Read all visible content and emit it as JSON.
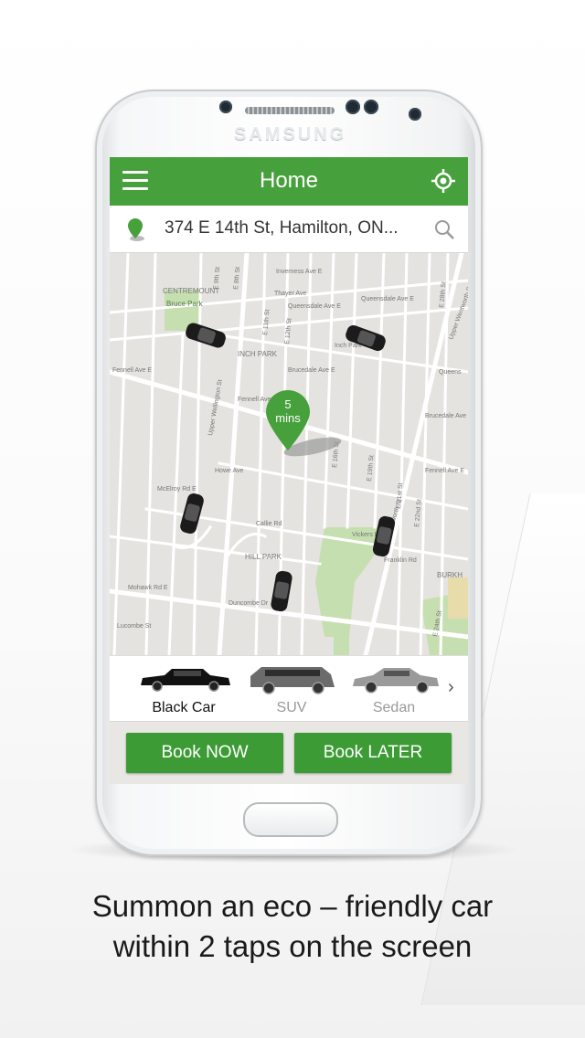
{
  "device": {
    "brand": "SAMSUNG"
  },
  "app": {
    "header": {
      "title": "Home",
      "menu_icon": "hamburger-menu-icon",
      "locate_icon": "crosshair-locate-icon"
    },
    "search": {
      "address": "374 E 14th St, Hamilton, ON...",
      "pin_icon": "location-pin-icon",
      "search_icon": "search-icon"
    },
    "map": {
      "eta": {
        "value": "5",
        "unit": "mins"
      },
      "labels": {
        "centremount": "CENTREMOUNT",
        "bruce_park": "Bruce Park",
        "inverness": "Inverness Ave E",
        "thayer": "Thayer Ave",
        "queensdale": "Queensdale Ave E",
        "inch_park": "INCH PARK",
        "inch_park2": "Inch Park",
        "brucedale": "Brucedale Ave E",
        "fennell": "Fennell Ave E",
        "fennell2": "Fennell Ave E",
        "fennell3": "Fennell Ave E",
        "hill_park": "HILL PARK",
        "mohawk": "Mohawk Rd E",
        "duncombe": "Duncombe Dr",
        "howe": "Howe Ave",
        "callie": "Callie Rd",
        "vickers": "Vickers Rd",
        "franklin": "Franklin Rd",
        "burkh": "BURKH",
        "upper_wellington": "Upper Wellington St",
        "upper_wentworth": "Upper Wentworth St",
        "queens": "Queens",
        "mcelroy": "McElroy Rd E",
        "lucombe": "Lucombe St",
        "e24": "E 24th St",
        "e22": "E 22nd St",
        "e21": "E 21st St",
        "e19": "E 19th St",
        "e16": "E 16th St",
        "e12": "E 12th St",
        "e11": "E 11th St",
        "e9": "E 9th St",
        "e8": "E 8th St",
        "e28": "E 28th St"
      }
    },
    "car_types": [
      {
        "label": "Black Car",
        "selected": true
      },
      {
        "label": "SUV",
        "selected": false
      },
      {
        "label": "Sedan",
        "selected": false
      }
    ],
    "buttons": {
      "book_now": "Book NOW",
      "book_later": "Book LATER"
    }
  },
  "caption": {
    "line1": "Summon an eco – friendly  car",
    "line2": "within 2 taps on the screen"
  },
  "colors": {
    "brand_green": "#46a03b",
    "button_green": "#3d9b35",
    "map_bg": "#e5e3df",
    "park_green": "#c6dfb0"
  }
}
